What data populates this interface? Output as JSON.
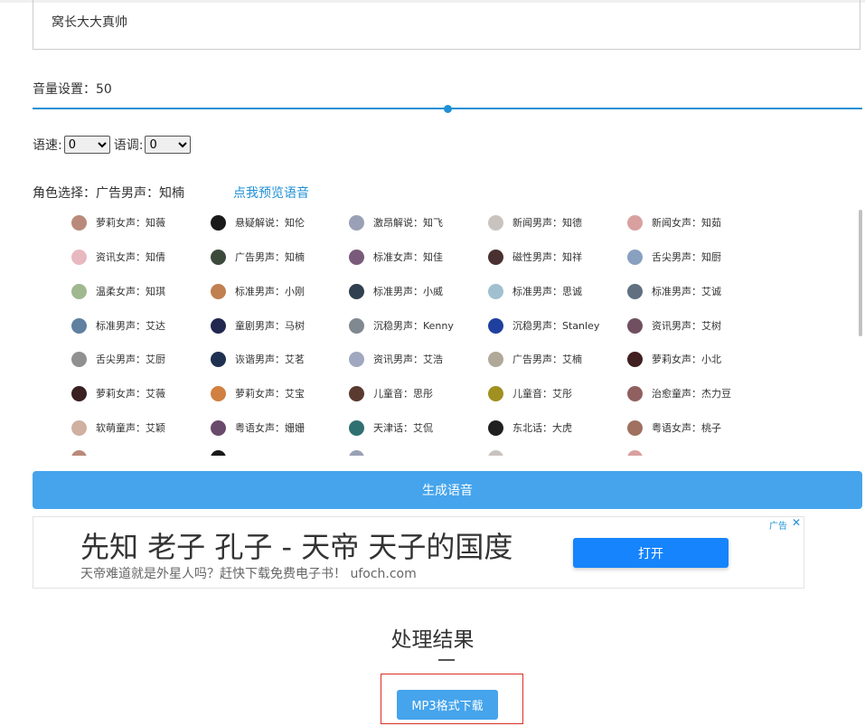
{
  "text_input": {
    "value": "窝长大大真帅"
  },
  "volume": {
    "label": "音量设置：",
    "value": "50",
    "max": 100
  },
  "speed": {
    "label": "语速:",
    "value": "0"
  },
  "pitch": {
    "label": "语调:",
    "value": "0"
  },
  "role": {
    "label": "角色选择：",
    "current": "广告男声：知楠",
    "preview_link": "点我预览语音"
  },
  "voices": [
    [
      "萝莉女声：知薇",
      "悬疑解说：知伦",
      "激昂解说：知飞",
      "新闻男声：知德",
      "新闻女声：知茹"
    ],
    [
      "资讯女声：知倩",
      "广告男声：知楠",
      "标准女声：知佳",
      "磁性男声：知祥",
      "舌尖男声：知厨"
    ],
    [
      "温柔女声：知琪",
      "标准男声：小刚",
      "标准男声：小威",
      "标准男声：思诚",
      "标准男声：艾诚"
    ],
    [
      "标准男声：艾达",
      "童剧男声：马树",
      "沉稳男声：Kenny",
      "沉稳男声：Stanley",
      "资讯男声：艾树"
    ],
    [
      "舌尖男声：艾厨",
      "诙谐男声：艾茗",
      "资讯男声：艾浩",
      "广告男声：艾楠",
      "萝莉女声：小北"
    ],
    [
      "萝莉女声：艾薇",
      "萝莉女声：艾宝",
      "儿童音：思彤",
      "儿童音：艾彤",
      "治愈童声：杰力豆"
    ],
    [
      "软萌童声：艾颖",
      "粤语女声：姗姗",
      "天津话：艾侃",
      "东北话：大虎",
      "粤语女声：桃子"
    ]
  ],
  "avatar_colors": [
    "#b98a7a",
    "#1a1a1a",
    "#9aa0b5",
    "#c9c3c0",
    "#d9a0a0",
    "#e8b8c0",
    "#3c4a3c",
    "#7a5a7a",
    "#4a3030",
    "#8aa0c0",
    "#a0b890",
    "#c08050",
    "#304050",
    "#a0c0d0",
    "#607080",
    "#6080a0",
    "#202850",
    "#808890",
    "#2040a0",
    "#705060",
    "#909090",
    "#203050",
    "#a0a8c0",
    "#b0a898",
    "#402020",
    "#3a2020",
    "#d08040",
    "#5a3a30",
    "#a09020",
    "#906060",
    "#d0b0a0",
    "#6a4a6a",
    "#307070",
    "#202020",
    "#a07060"
  ],
  "generate_button": "生成语音",
  "ad": {
    "title": "先知 老子 孔子 - 天帝 天子的国度",
    "subtitle": "天帝难道就是外星人吗？赶快下载免费电子书！ ufoch.com",
    "open_button": "打开",
    "tag": "广告",
    "close": "✕"
  },
  "result": {
    "title": "处理结果",
    "download_button": "MP3格式下载"
  }
}
